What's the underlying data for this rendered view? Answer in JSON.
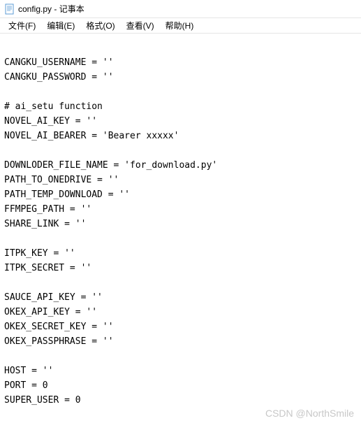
{
  "window": {
    "title": "config.py - 记事本"
  },
  "menu": {
    "file": "文件(F)",
    "edit": "编辑(E)",
    "format": "格式(O)",
    "view": "查看(V)",
    "help": "帮助(H)"
  },
  "content": {
    "text": "\nCANGKU_USERNAME = ''\nCANGKU_PASSWORD = ''\n\n# ai_setu function\nNOVEL_AI_KEY = ''\nNOVEL_AI_BEARER = 'Bearer xxxxx'\n\nDOWNLODER_FILE_NAME = 'for_download.py'\nPATH_TO_ONEDRIVE = ''\nPATH_TEMP_DOWNLOAD = ''\nFFMPEG_PATH = ''\nSHARE_LINK = ''\n\nITPK_KEY = ''\nITPK_SECRET = ''\n\nSAUCE_API_KEY = ''\nOKEX_API_KEY = ''\nOKEX_SECRET_KEY = ''\nOKEX_PASSPHRASE = ''\n\nHOST = ''\nPORT = 0\nSUPER_USER = 0"
  },
  "watermark": {
    "text": "CSDN @NorthSmile"
  }
}
